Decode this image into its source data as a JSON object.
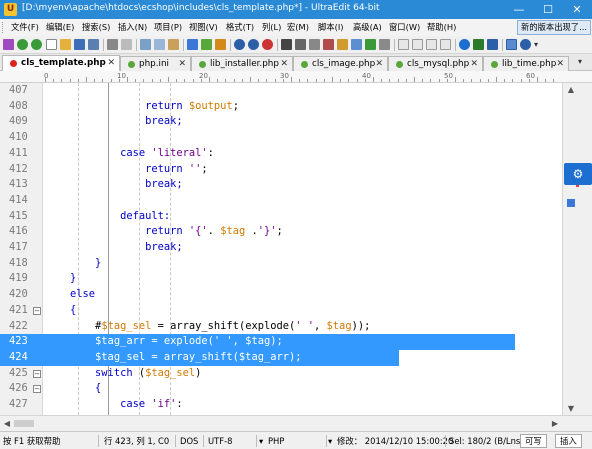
{
  "window": {
    "title": "[D:\\myenv\\apache\\htdocs\\ecshop\\includes\\cls_template.php*] - UltraEdit 64-bit",
    "minimize": "—",
    "maximize": "☐",
    "close": "✕"
  },
  "menu": {
    "items": [
      "文件(F)",
      "编辑(E)",
      "搜索(S)",
      "插入(N)",
      "项目(P)",
      "视图(V)",
      "格式(T)",
      "列(L)",
      "宏(M)",
      "脚本(I)",
      "高级(A)",
      "窗口(W)",
      "帮助(H)"
    ],
    "notice": "新的版本出现了..."
  },
  "tabs": [
    {
      "label": "cls_template.php",
      "active": true,
      "modified": true
    },
    {
      "label": "php.ini",
      "active": false,
      "modified": false
    },
    {
      "label": "lib_installer.php",
      "active": false,
      "modified": false
    },
    {
      "label": "cls_image.php",
      "active": false,
      "modified": false
    },
    {
      "label": "cls_mysql.php",
      "active": false,
      "modified": false
    },
    {
      "label": "lib_time.php",
      "active": false,
      "modified": false
    }
  ],
  "ruler": {
    "labels": [
      "0",
      "10",
      "20",
      "30",
      "40",
      "50",
      "60"
    ]
  },
  "editor": {
    "lines": [
      {
        "n": "407",
        "code": ""
      },
      {
        "n": "408",
        "code": "                return $output;"
      },
      {
        "n": "409",
        "code": "                break;"
      },
      {
        "n": "410",
        "code": ""
      },
      {
        "n": "411",
        "code": "            case 'literal':"
      },
      {
        "n": "412",
        "code": "                return '';"
      },
      {
        "n": "413",
        "code": "                break;"
      },
      {
        "n": "414",
        "code": ""
      },
      {
        "n": "415",
        "code": "            default:"
      },
      {
        "n": "416",
        "code": "                return '{'. $tag .'}';"
      },
      {
        "n": "417",
        "code": "                break;"
      },
      {
        "n": "418",
        "code": "        }"
      },
      {
        "n": "419",
        "code": "    }"
      },
      {
        "n": "420",
        "code": "    else"
      },
      {
        "n": "421",
        "code": "    {"
      },
      {
        "n": "422",
        "code": "        #$tag_sel = array_shift(explode(' ', $tag));"
      },
      {
        "n": "423",
        "code": "        $tag_arr = explode(' ', $tag);"
      },
      {
        "n": "424",
        "code": "        $tag_sel = array_shift($tag_arr);"
      },
      {
        "n": "425",
        "code": "        switch ($tag_sel)"
      },
      {
        "n": "426",
        "code": "        {"
      },
      {
        "n": "427",
        "code": "            case 'if':"
      }
    ]
  },
  "status": {
    "help": "按 F1 获取帮助",
    "position": "行 423, 列 1, C0",
    "line_ending": "DOS",
    "encoding": "UTF-8",
    "syntax": "PHP",
    "modified": "修改： 2014/12/10 15:00:20",
    "selection": "Sel: 180/2 (B/Lns)",
    "writable": "可写",
    "insert": "插入"
  }
}
